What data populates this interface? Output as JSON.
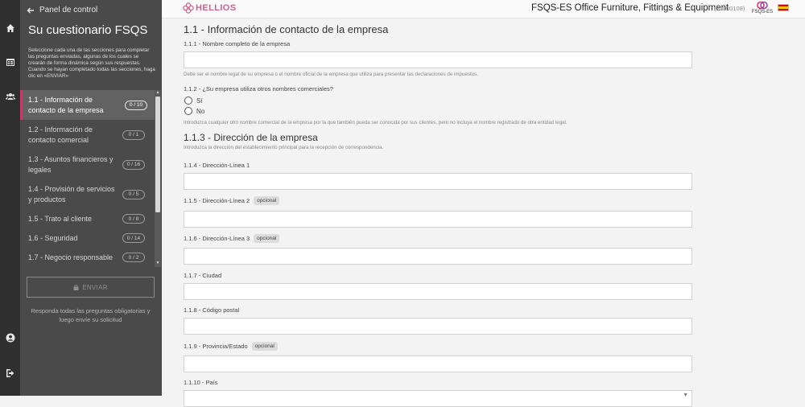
{
  "nav": {
    "icons": [
      "home-icon",
      "calendar-icon",
      "users-icon",
      "user-account-icon",
      "logout-icon"
    ]
  },
  "sidebar": {
    "back_label": "Panel de control",
    "title": "Su cuestionario FSQS",
    "description": "Seleccione cada una de las secciones para completar las preguntas enviadas, algunas de los cuales se crearán de forma dinámica según sus respuestas. Cuando se hayan completado todas las secciones, haga clic en «ENVIAR»",
    "sections": [
      {
        "label": "1.1 - Información de contacto de la empresa",
        "count": "0 / 10",
        "active": true
      },
      {
        "label": "1.2 - Información de contacto comercial",
        "count": "0 / 1",
        "active": false
      },
      {
        "label": "1.3 - Asuntos financieros y legales",
        "count": "0 / 16",
        "active": false
      },
      {
        "label": "1.4 - Provisión de servicios y productos",
        "count": "0 / 5",
        "active": false
      },
      {
        "label": "1.5 - Trato al cliente",
        "count": "0 / 8",
        "active": false
      },
      {
        "label": "1.6 - Seguridad",
        "count": "0 / 14",
        "active": false
      },
      {
        "label": "1.7 - Negocio responsable",
        "count": "0 / 2",
        "active": false
      }
    ],
    "send_label": "ENVIAR",
    "send_note": "Responda todas las preguntas obligatorias y luego envíe su solicitud"
  },
  "header": {
    "logo_text": "HELLIOS",
    "company_name": "FSQS-ES Office Furniture, Fittings & Equipment",
    "company_id": "(20000108)",
    "brand_label": "FSQS-ES",
    "accent_color": "#d6336c"
  },
  "form": {
    "section_title": "1.1 - Información de contacto de la empresa",
    "q1_label": "1.1.1 - Nombre completo de la empresa",
    "q1_value": "",
    "q1_hint": "Debe ser el nombre legal de su empresa o el nombre oficial de la empresa que utiliza para presentar las declaraciones de impuestos.",
    "q2_label": "1.1.2 - ¿Su empresa utiliza otros nombres comerciales?",
    "q2_options": [
      "Sí",
      "No"
    ],
    "q2_hint": "Introduzca cualquier otro nombre comercial de la empresa por la que también pueda ser conocida por sus clientes, pero no incluya el nombre registrado de otra entidad legal.",
    "address_title": "1.1.3 - Dirección de la empresa",
    "address_hint": "Introduzca la dirección del establecimiento principal para la recepción de correspondencia.",
    "optional_label": "opcional",
    "fields": [
      {
        "label": "1.1.4 - Dirección-Línea 1",
        "value": ""
      },
      {
        "label": "1.1.5 - Dirección-Línea 2",
        "value": ""
      },
      {
        "label": "1.1.6 - Dirección-Línea 3",
        "value": ""
      },
      {
        "label": "1.1.7 - Ciudad",
        "value": ""
      },
      {
        "label": "1.1.8 - Código postal",
        "value": ""
      },
      {
        "label": "1.1.9 - Provincia/Estado",
        "value": ""
      },
      {
        "label": "1.1.10 - País",
        "value": ""
      }
    ]
  }
}
